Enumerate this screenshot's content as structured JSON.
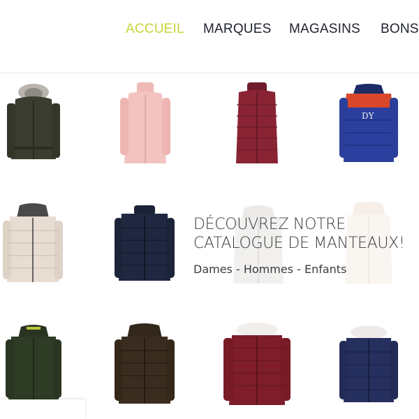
{
  "nav": {
    "items": [
      {
        "label": "ACCUEIL",
        "active": true
      },
      {
        "label": "MARQUES",
        "active": false
      },
      {
        "label": "MAGASINS",
        "active": false
      },
      {
        "label": "BONS",
        "active": false
      }
    ],
    "accent_color": "#c8d43a"
  },
  "promo": {
    "title_line1": "DÉCOUVREZ NOTRE",
    "title_line2": "CATALOGUE DE MANTEAUX!",
    "subtitle": "Dames - Hommes - Enfants"
  },
  "products": [
    {
      "name": "olive-parka-fur-hood",
      "color": "#3b3d30"
    },
    {
      "name": "pink-wool-coat",
      "color": "#f2c3c0"
    },
    {
      "name": "burgundy-puffer-vest",
      "color": "#8a2435"
    },
    {
      "name": "blue-red-kids-puffer",
      "color": "#2a3f9e"
    },
    {
      "name": "cream-puffer-jacket",
      "color": "#e8ddd3"
    },
    {
      "name": "navy-puffer-jacket",
      "color": "#1f2840"
    },
    {
      "name": "white-puffer-faded",
      "color": "#e9e6e4"
    },
    {
      "name": "beige-coat-faded",
      "color": "#efe3d8"
    },
    {
      "name": "green-hooded-jacket",
      "color": "#2e3b25"
    },
    {
      "name": "brown-hooded-puffer",
      "color": "#3a2c1f"
    },
    {
      "name": "burgundy-puffer-fur-hood",
      "color": "#7f1d2a"
    },
    {
      "name": "navy-puffer-fur-hood",
      "color": "#25305e"
    }
  ]
}
